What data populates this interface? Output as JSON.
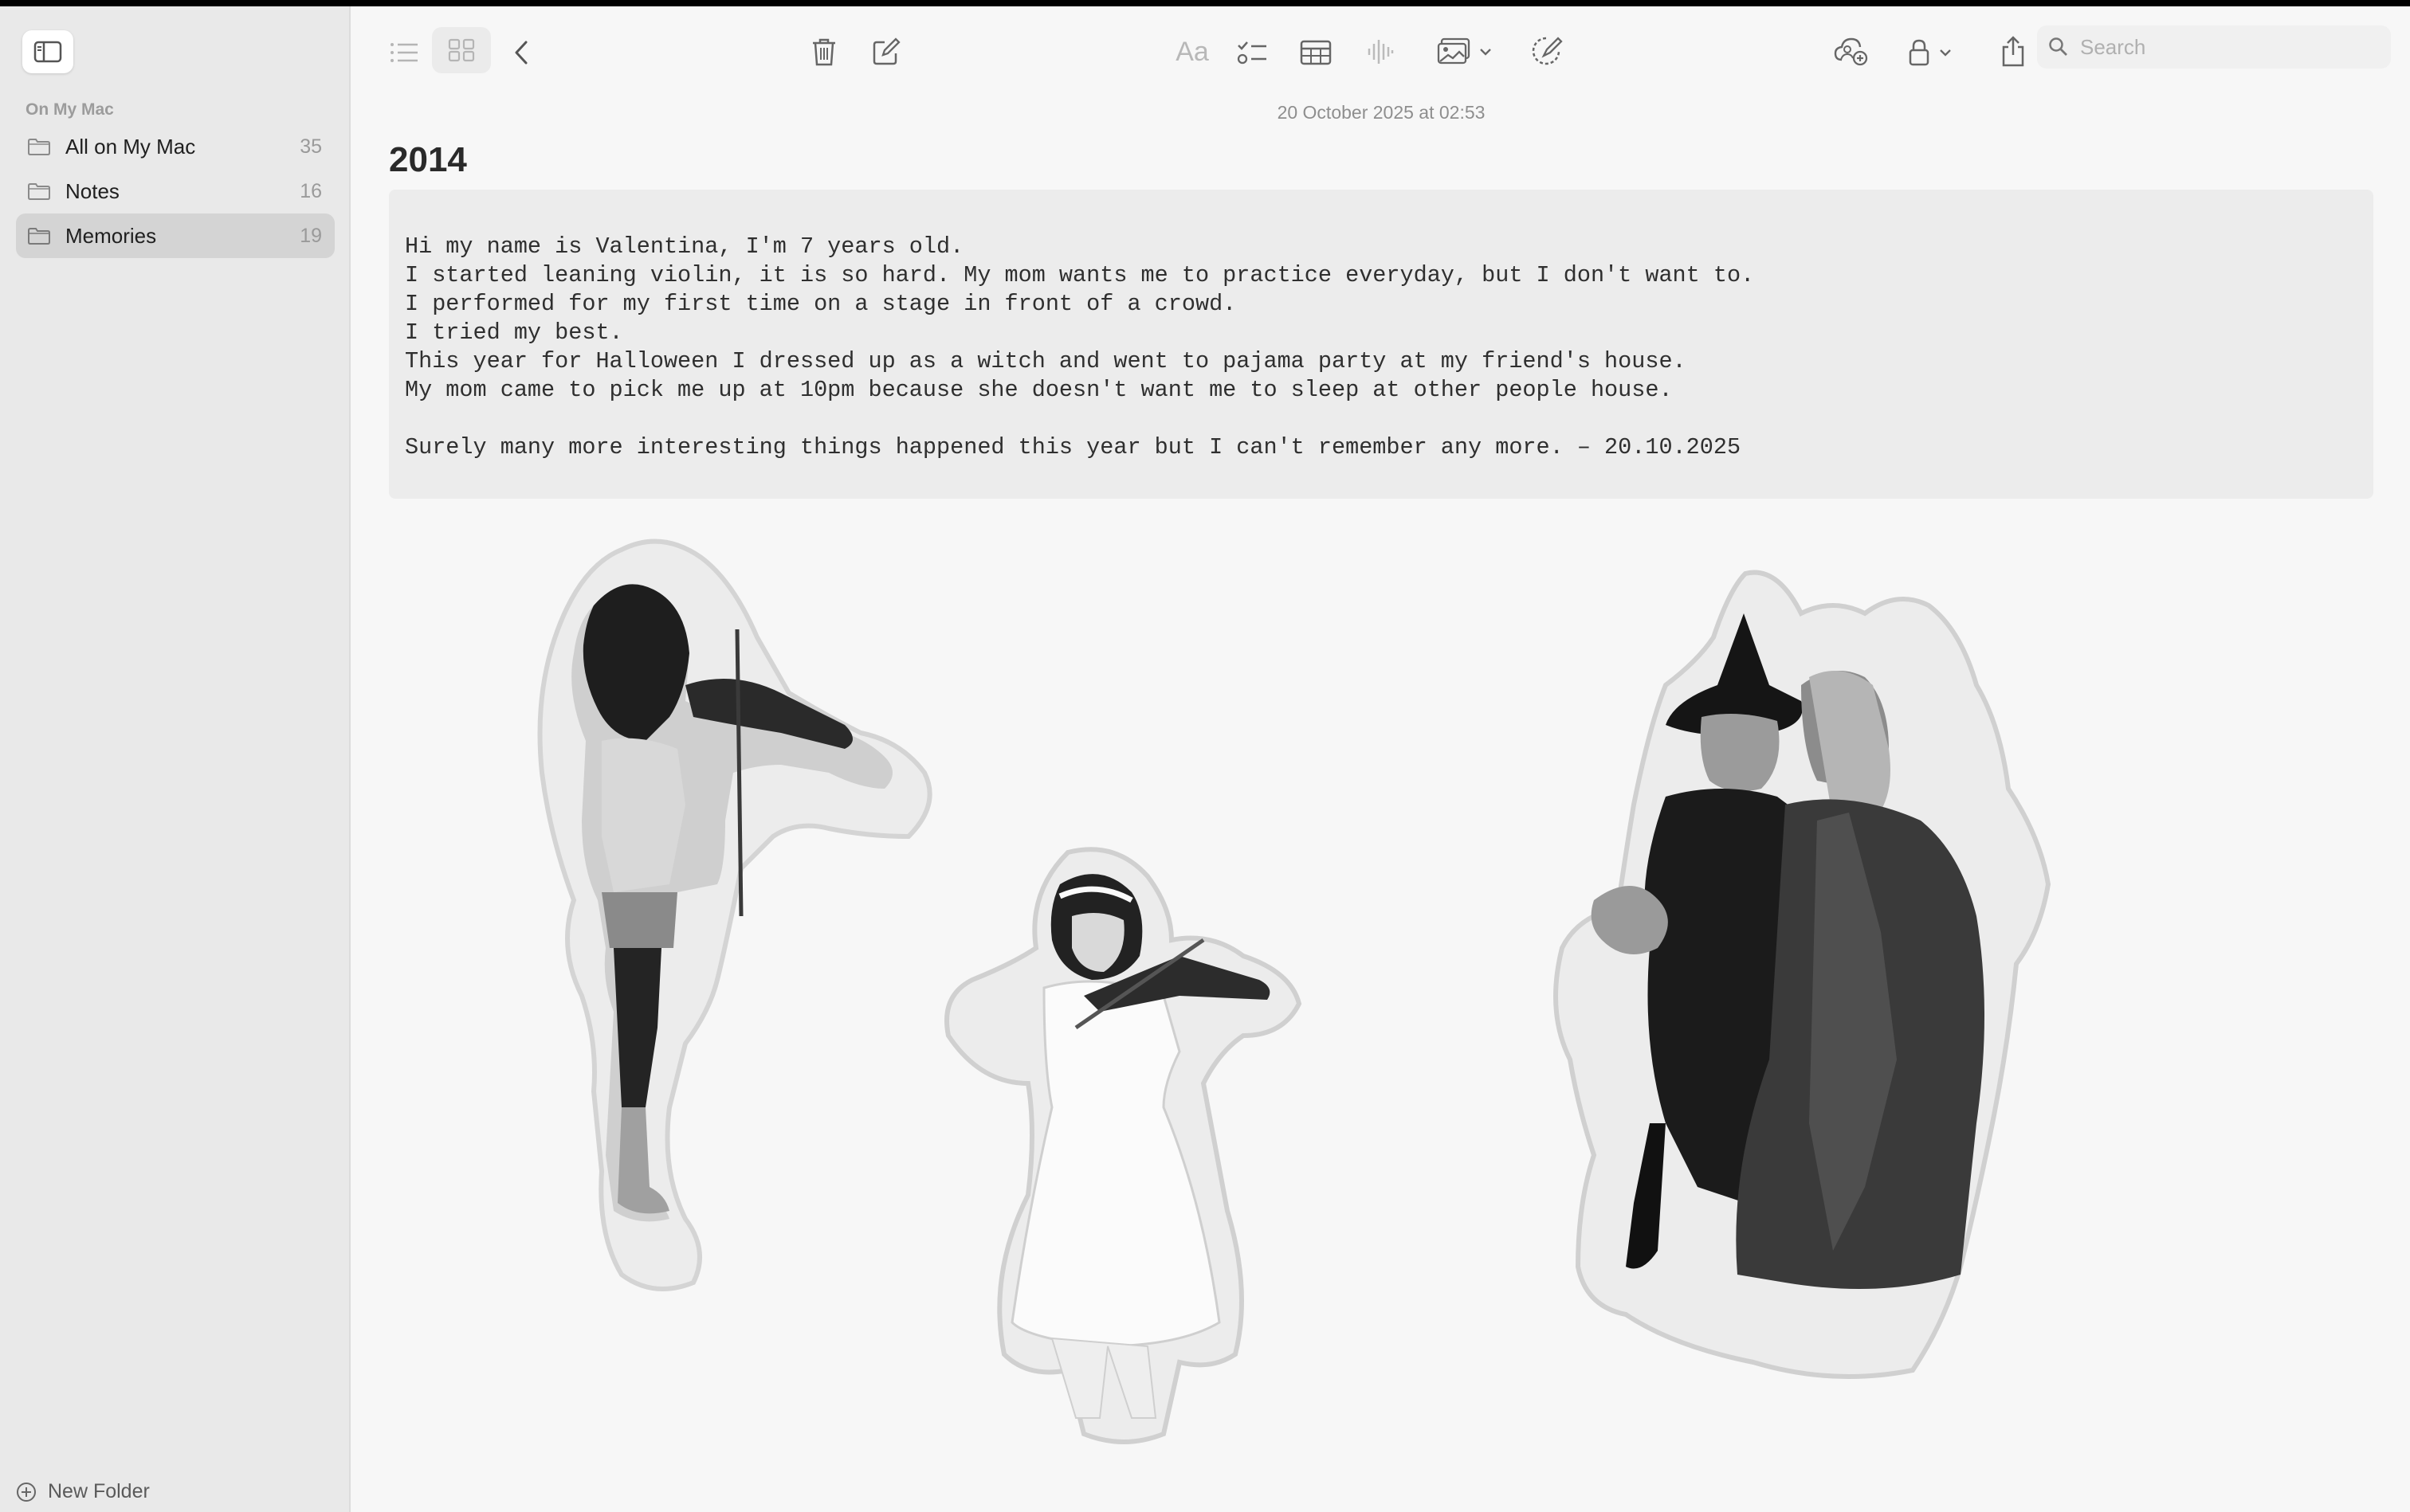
{
  "sidebar": {
    "section_label": "On My Mac",
    "folders": [
      {
        "label": "All on My Mac",
        "count": "35",
        "selected": false
      },
      {
        "label": "Notes",
        "count": "16",
        "selected": false
      },
      {
        "label": "Memories",
        "count": "19",
        "selected": true
      }
    ],
    "new_folder_label": "New Folder"
  },
  "toolbar": {
    "format_label": "Aa",
    "search_placeholder": "Search",
    "icons": [
      "sidebar-toggle-icon",
      "list-view-icon",
      "gallery-view-icon",
      "back-chevron-icon",
      "trash-icon",
      "compose-icon",
      "format-text-icon",
      "checklist-icon",
      "table-icon",
      "audio-waveform-icon",
      "media-icon",
      "writing-tools-icon",
      "collaborate-icon",
      "lock-icon",
      "share-icon",
      "search-icon"
    ]
  },
  "note": {
    "date": "20 October 2025 at 02:53",
    "title": "2014",
    "lines": [
      "Hi my name is Valentina, I'm 7 years old.",
      "I started leaning violin, it is so hard. My mom wants me to practice everyday, but I don't want to.",
      "I performed for my first time on a stage in front of a crowd.",
      "I tried my best.",
      "This year for Halloween I dressed up as a witch and went to pajama party at my friend's house.",
      "My mom came to pick me up at 10pm because she doesn't want me to sleep at other people house.",
      "",
      "Surely many more interesting things happened this year but I can't remember any more. – 20.10.2025"
    ],
    "stickers": [
      {
        "name": "girl-playing-violin-sticker",
        "description": "violin"
      },
      {
        "name": "girl-in-white-dress-violin-sticker",
        "description": "violin"
      },
      {
        "name": "halloween-witch-costume-sticker",
        "description": "witch"
      }
    ]
  },
  "colors": {
    "sidebar_bg": "#e9e9e9",
    "selected_row": "#d4d4d4",
    "main_bg": "#f7f7f7",
    "code_bg": "#ececec"
  }
}
